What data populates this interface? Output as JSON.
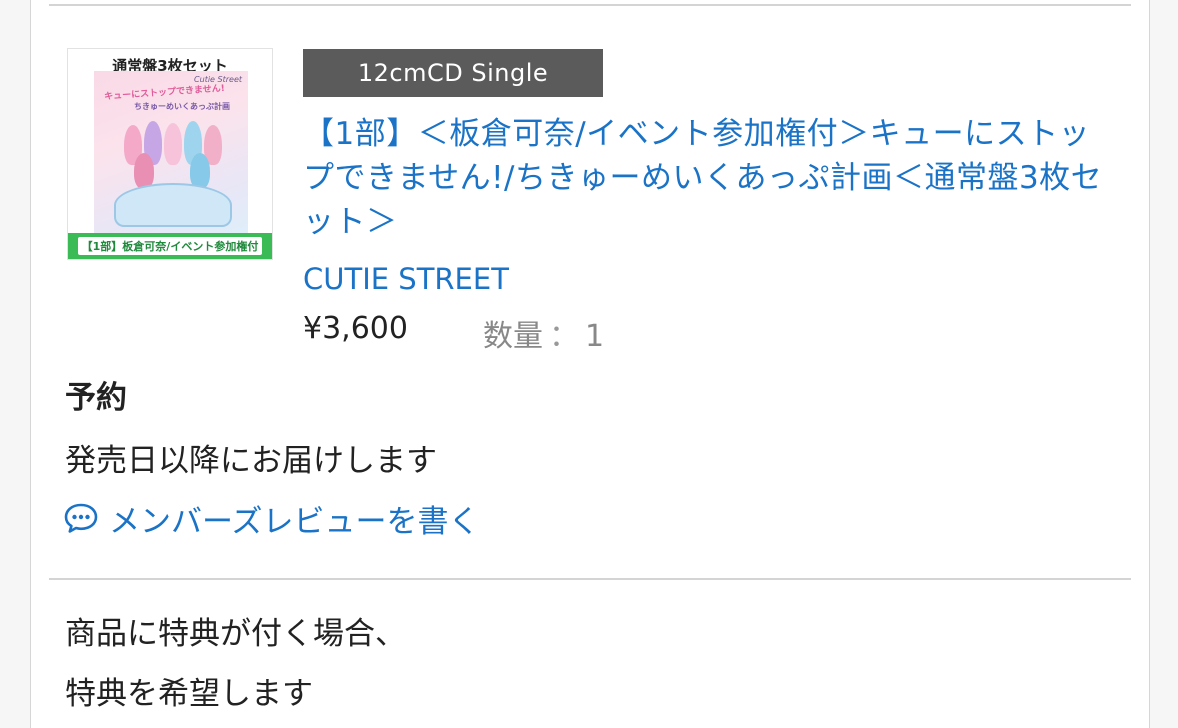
{
  "product": {
    "format_badge": "12cmCD Single",
    "title": "【1部】＜板倉可奈/イベント参加権付＞キューにストップできません!/ちきゅーめいくあっぷ計画＜通常盤3枚セット＞",
    "artist": "CUTIE STREET",
    "price": "¥3,600",
    "quantity_label": "数量",
    "quantity_colon": "：",
    "quantity_value": "1",
    "thumbnail": {
      "header": "通常盤3枚セット",
      "logo": "Cutie Street",
      "art_line1": "キューにストップできません!",
      "art_line2": "ちきゅーめいくあっぷ計画",
      "band": "【1部】板倉可奈/イベント参加権付"
    }
  },
  "order": {
    "status": "予約",
    "delivery_note": "発売日以降にお届けします"
  },
  "review": {
    "label": "メンバーズレビューを書く",
    "icon": "speech-bubble-icon"
  },
  "bonus": {
    "line1": "商品に特典が付く場合、",
    "line2": "特典を希望します"
  },
  "colors": {
    "link": "#1a73c6",
    "badge_bg": "#5b5b5b",
    "band_green": "#3bbb55"
  }
}
